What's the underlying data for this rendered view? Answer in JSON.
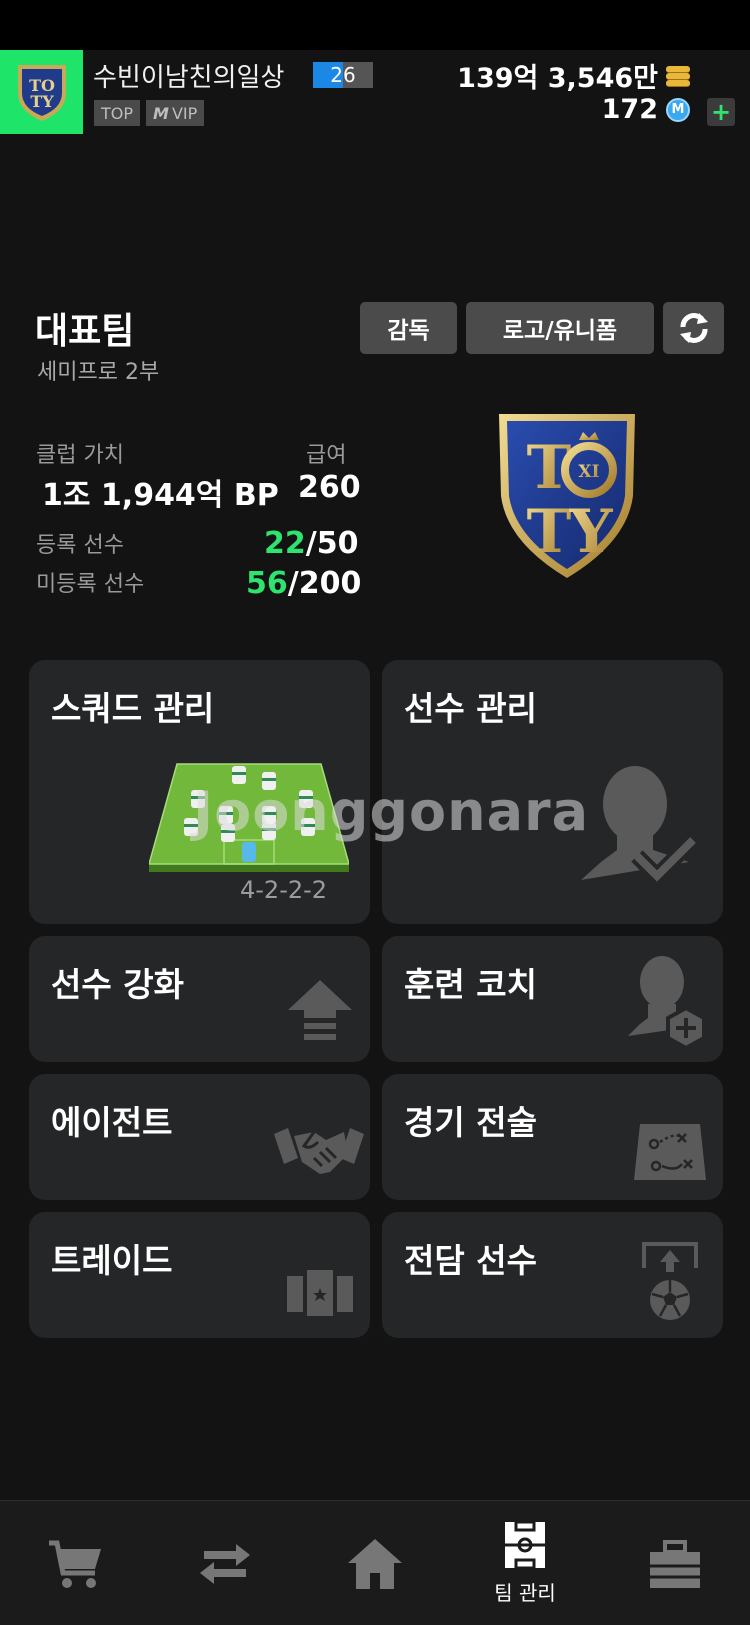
{
  "header": {
    "username": "수빈이남친의일상",
    "level": "26",
    "badge_top": "TOP",
    "badge_vip": "VIP",
    "bp_amount": "139억 3,546만",
    "m_amount": "172"
  },
  "team": {
    "title": "대표팀",
    "division": "세미프로 2부",
    "coach_button": "감독",
    "logo_button": "로고/유니폼",
    "club_value_label": "클럽 가치",
    "club_value": "1조 1,944억 BP",
    "salary_label": "급여",
    "salary": "260",
    "registered_label": "등록 선수",
    "registered_count": "22",
    "registered_max": "/50",
    "unregistered_label": "미등록 선수",
    "unregistered_count": "56",
    "unregistered_max": "/200"
  },
  "cards": {
    "squad": "스쿼드 관리",
    "formation": "4-2-2-2",
    "players": "선수 관리",
    "upgrade": "선수 강화",
    "training": "훈련 코치",
    "agent": "에이전트",
    "tactics": "경기 전술",
    "trade": "트레이드",
    "dedicated": "전담 선수"
  },
  "watermark": "Joonggonara",
  "nav": {
    "active_label": "팀 관리"
  },
  "colors": {
    "accent_green": "#2fe36f",
    "background": "#131313",
    "card": "#252628"
  }
}
